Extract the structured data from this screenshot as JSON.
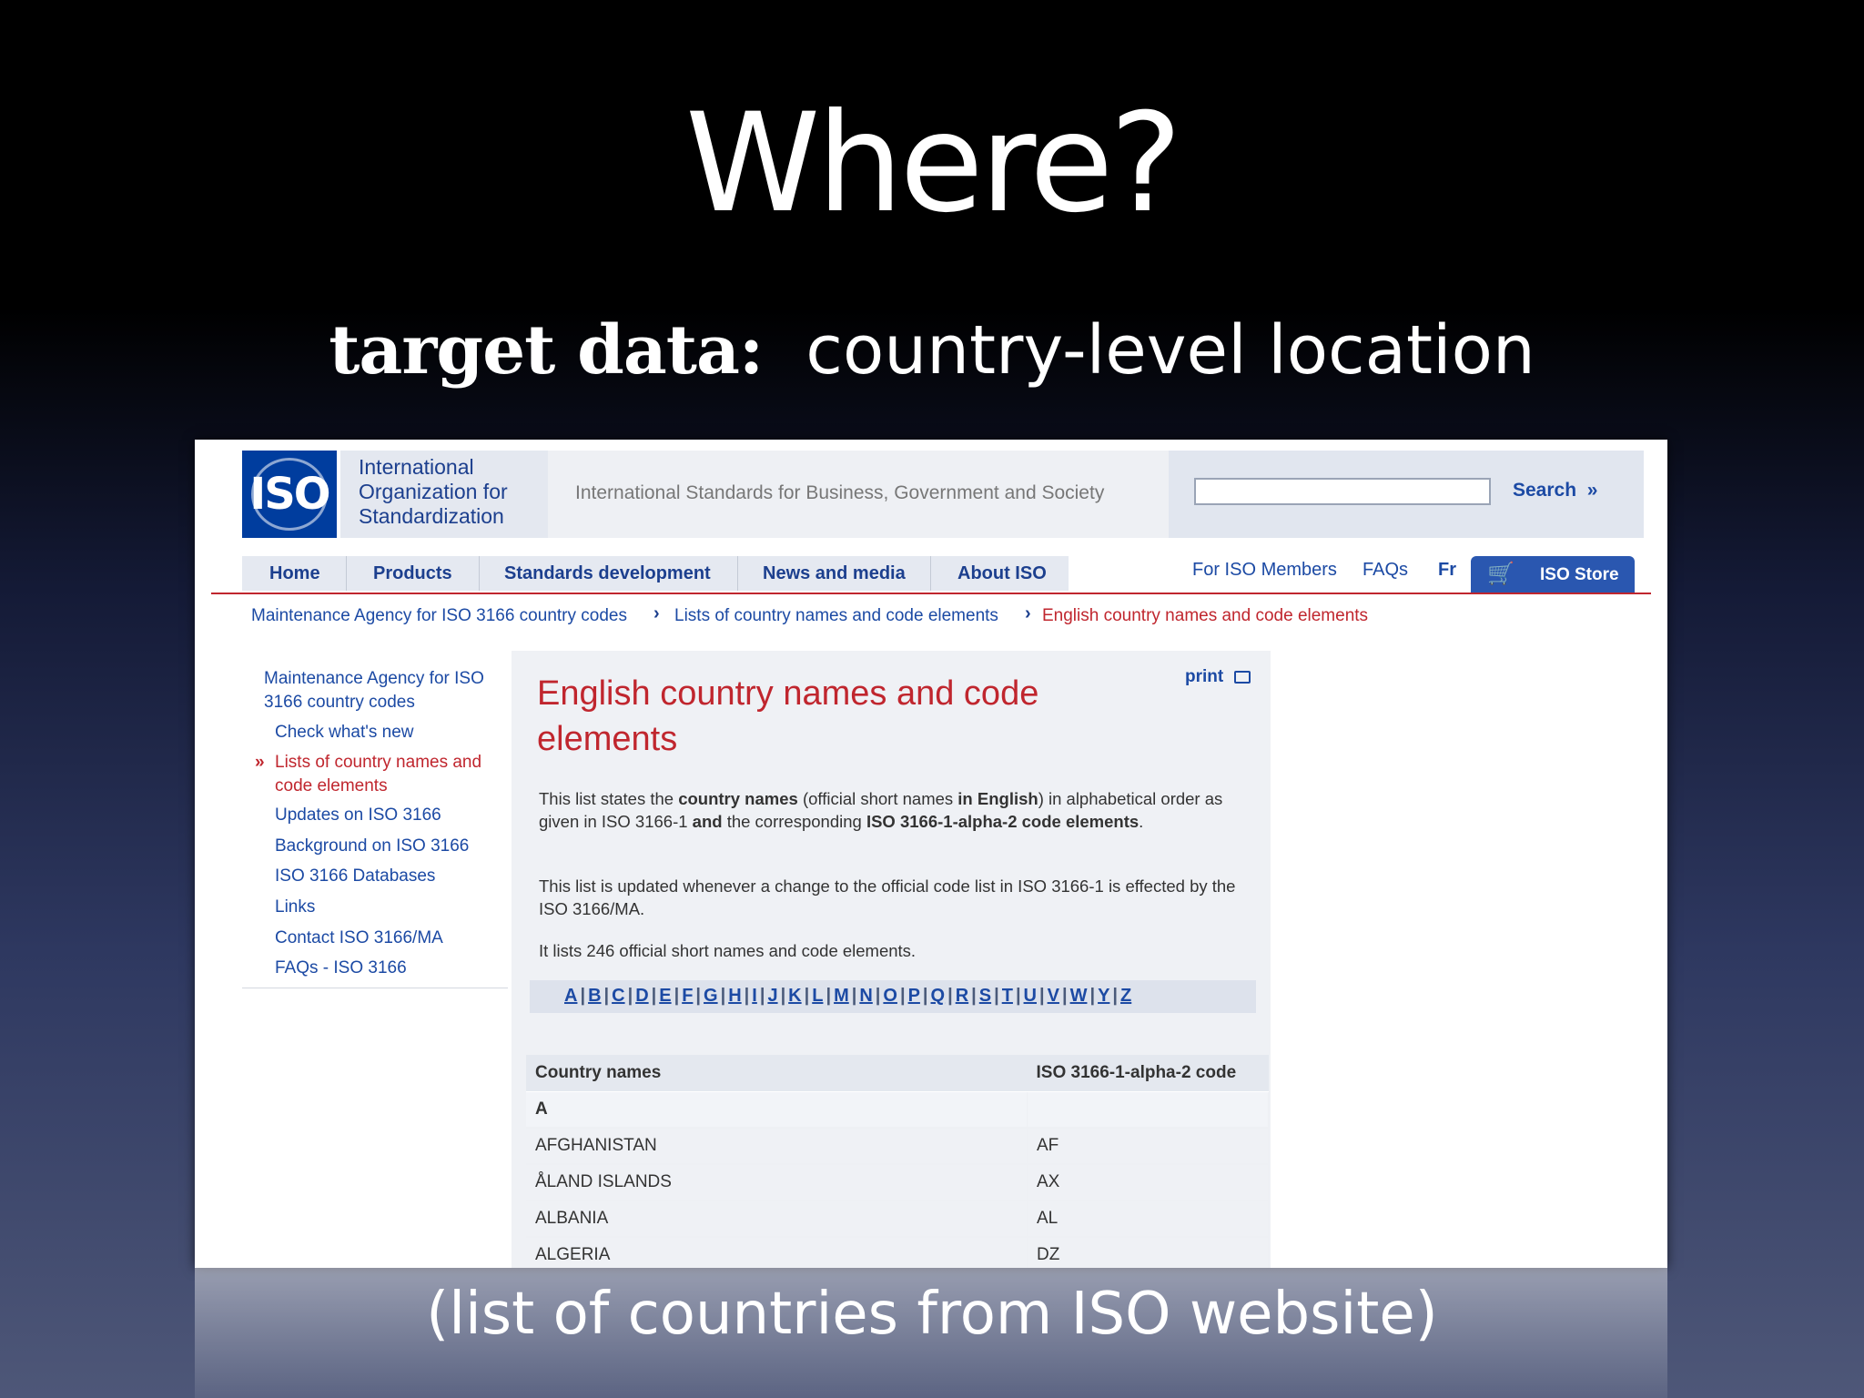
{
  "slide": {
    "title": "Where?",
    "subtitle_bold": "target data:",
    "subtitle_rest": "country-level location",
    "caption": "(list of countries from ISO website)"
  },
  "site": {
    "logo_text": "ISO",
    "org_line1": "International",
    "org_line2": "Organization for",
    "org_line3": "Standardization",
    "tagline": "International Standards for Business, Government and Society",
    "search_value": "",
    "search_label": "Search",
    "nav": [
      "Home",
      "Products",
      "Standards development",
      "News and media",
      "About ISO"
    ],
    "members_link": "For ISO Members",
    "faqs_link": "FAQs",
    "fr_link": "Fr",
    "store_label": "ISO Store",
    "breadcrumb": {
      "item1": "Maintenance Agency for ISO 3166 country codes",
      "item2": "Lists of country names and code elements",
      "item3": "English country names and code elements"
    },
    "sidebar": {
      "top_line1": "Maintenance Agency for ISO",
      "top_line2": "3166 country codes",
      "items": [
        "Check what's new",
        "Lists of country names and",
        "code elements",
        "Updates on ISO 3166",
        "Background on ISO 3166",
        "ISO 3166 Databases",
        "Links",
        "Contact ISO 3166/MA",
        "FAQs - ISO 3166"
      ]
    },
    "page_title_line1": "English country names and code",
    "page_title_line2": "elements",
    "print_label": "print",
    "para1": {
      "a": "This list states the ",
      "b": "country names",
      "c": " (official short names ",
      "d": "in English",
      "e": ") in alphabetical order as given in ISO 3166-1 ",
      "f": "and",
      "g": " the corresponding ",
      "h": "ISO 3166-1-alpha-2 code elements",
      "i": "."
    },
    "para2": "This list is updated whenever a change to the official code list in ISO 3166-1 is effected by the ISO 3166/MA.",
    "para3": "It lists 246 official short names and code elements.",
    "alphabet": [
      "A",
      "B",
      "C",
      "D",
      "E",
      "F",
      "G",
      "H",
      "I",
      "J",
      "K",
      "L",
      "M",
      "N",
      "O",
      "P",
      "Q",
      "R",
      "S",
      "T",
      "U",
      "V",
      "W",
      "Y",
      "Z"
    ],
    "table": {
      "headers": [
        "Country names",
        "ISO 3166-1-alpha-2 code"
      ],
      "letter_row": "A",
      "rows": [
        [
          "AFGHANISTAN",
          "AF"
        ],
        [
          "ÅLAND ISLANDS",
          "AX"
        ],
        [
          "ALBANIA",
          "AL"
        ],
        [
          "ALGERIA",
          "DZ"
        ]
      ]
    }
  },
  "colors": {
    "iso_blue": "#003d9e",
    "link_blue": "#1c4aa4",
    "accent_red": "#c0262e"
  }
}
